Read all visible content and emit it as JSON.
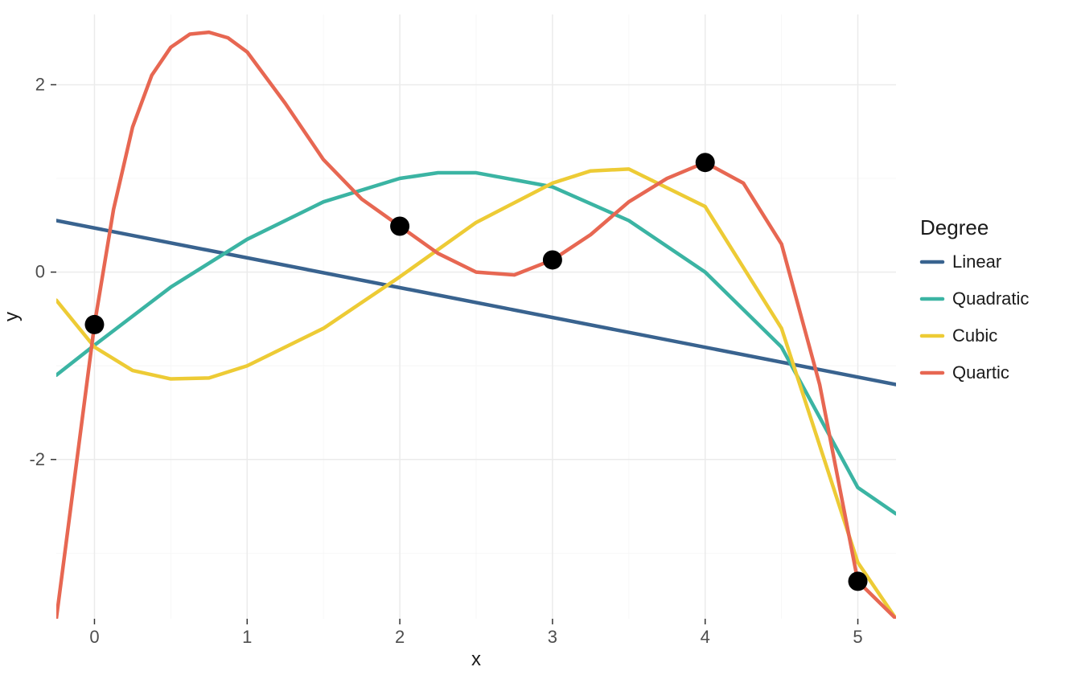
{
  "chart_data": {
    "type": "line",
    "xlabel": "x",
    "ylabel": "y",
    "xlim": [
      -0.25,
      5.25
    ],
    "ylim": [
      -3.7,
      2.75
    ],
    "x_ticks": [
      0,
      1,
      2,
      3,
      4,
      5
    ],
    "y_ticks": [
      -2,
      0,
      2
    ],
    "x_minor": [
      0.5,
      1.5,
      2.5,
      3.5,
      4.5
    ],
    "y_minor": [
      -3,
      -1,
      1
    ],
    "points": [
      {
        "x": 0,
        "y": -0.56
      },
      {
        "x": 2,
        "y": 0.49
      },
      {
        "x": 3,
        "y": 0.13
      },
      {
        "x": 4,
        "y": 1.17
      },
      {
        "x": 5,
        "y": -3.3
      }
    ],
    "series": [
      {
        "name": "Linear",
        "color": "#39638F",
        "x": [
          -0.25,
          5.25
        ],
        "y": [
          0.55,
          -1.2
        ]
      },
      {
        "name": "Quadratic",
        "color": "#3BB4A3",
        "x": [
          -0.25,
          0,
          0.5,
          1,
          1.5,
          2,
          2.25,
          2.5,
          3,
          3.5,
          4,
          4.5,
          5,
          5.25
        ],
        "y": [
          -1.1,
          -0.78,
          -0.16,
          0.35,
          0.75,
          1.0,
          1.06,
          1.06,
          0.91,
          0.55,
          0.0,
          -0.8,
          -2.3,
          -2.58
        ]
      },
      {
        "name": "Cubic",
        "color": "#EDCB35",
        "x": [
          -0.25,
          0,
          0.25,
          0.5,
          0.75,
          1,
          1.5,
          2,
          2.5,
          3,
          3.25,
          3.5,
          4,
          4.5,
          5,
          5.25
        ],
        "y": [
          -0.3,
          -0.8,
          -1.05,
          -1.14,
          -1.13,
          -1.0,
          -0.6,
          -0.05,
          0.53,
          0.95,
          1.08,
          1.1,
          0.7,
          -0.6,
          -3.1,
          -3.7
        ]
      },
      {
        "name": "Quartic",
        "color": "#E76752",
        "x": [
          -0.25,
          0,
          0.125,
          0.25,
          0.375,
          0.5,
          0.625,
          0.75,
          0.875,
          1,
          1.25,
          1.5,
          1.75,
          2,
          2.25,
          2.5,
          2.75,
          3,
          3.25,
          3.5,
          3.75,
          4,
          4.25,
          4.5,
          4.75,
          5,
          5.25
        ],
        "y": [
          -3.7,
          -0.56,
          0.67,
          1.55,
          2.1,
          2.4,
          2.54,
          2.56,
          2.5,
          2.35,
          1.8,
          1.2,
          0.78,
          0.49,
          0.2,
          0.0,
          -0.03,
          0.13,
          0.4,
          0.75,
          1.0,
          1.17,
          0.95,
          0.3,
          -1.2,
          -3.3,
          -3.7
        ]
      }
    ],
    "legend_title": "Degree"
  },
  "colors": {
    "Linear": "#39638F",
    "Quadratic": "#3BB4A3",
    "Cubic": "#EDCB35",
    "Quartic": "#E76752"
  }
}
